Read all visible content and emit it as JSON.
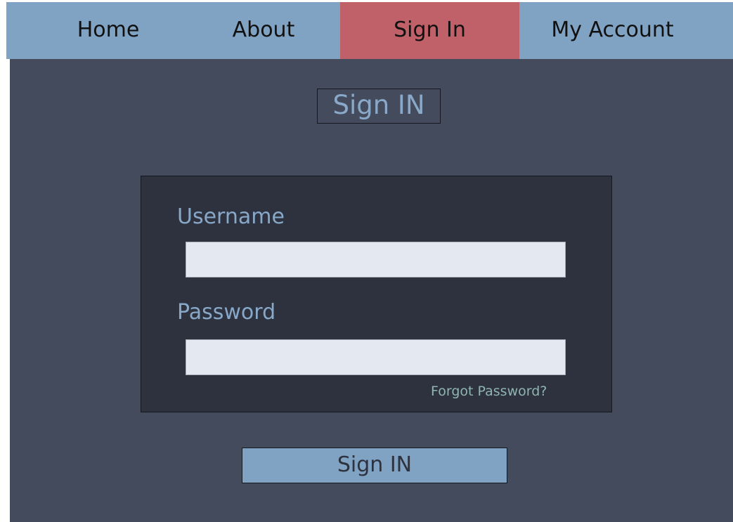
{
  "nav": {
    "items": [
      {
        "label": "Home"
      },
      {
        "label": "About"
      },
      {
        "label": "Sign In",
        "active": true
      },
      {
        "label": "My Account"
      }
    ],
    "bar_color": "#80a2c3",
    "active_color": "#c06068"
  },
  "page": {
    "title": "Sign IN",
    "background": "#444b5d"
  },
  "form": {
    "username_label": "Username",
    "username_value": "",
    "password_label": "Password",
    "password_value": "",
    "forgot_label": "Forgot Password?",
    "submit_label": "Sign IN"
  }
}
